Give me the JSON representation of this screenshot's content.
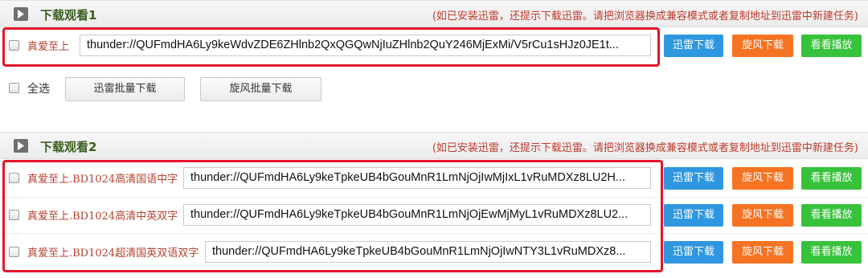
{
  "section1": {
    "title": "下载观看1",
    "hint": "(如已安装迅雷，还提示下载迅雷。请把浏览器换成兼容模式或者复制地址到迅雷中新建任务)",
    "items": [
      {
        "label": "真爱至上",
        "link": "thunder://QUFmdHA6Ly9keWdvZDE6ZHlnb2QxQGQwNjIuZHlnb2QuY246MjExMi/V5rCu1sHJz0JE1t..."
      }
    ],
    "select_all_label": "全选",
    "batch_xunlei": "迅雷批量下载",
    "batch_xuanfeng": "旋风批量下载"
  },
  "section2": {
    "title": "下载观看2",
    "hint": "(如已安装迅雷，还提示下载迅雷。请把浏览器换成兼容模式或者复制地址到迅雷中新建任务)",
    "items": [
      {
        "label": "真爱至上.BD1024高清国语中字",
        "link": "thunder://QUFmdHA6Ly9keTpkeUB4bGouMnR1LmNjOjIwMjIxL1vRuMDXz8LU2H..."
      },
      {
        "label": "真爱至上.BD1024高清中英双字",
        "link": "thunder://QUFmdHA6Ly9keTpkeUB4bGouMnR1LmNjOjEwMjMyL1vRuMDXz8LU2..."
      },
      {
        "label": "真爱至上.BD1024超清国英双语双字",
        "link": "thunder://QUFmdHA6Ly9keTpkeUB4bGouMnR1LmNjOjIwNTY3L1vRuMDXz8..."
      }
    ]
  },
  "buttons": {
    "xunlei": "迅雷下载",
    "xuanfeng": "旋风下载",
    "play": "看看播放"
  },
  "colors": {
    "title_green": "#3a5e1e",
    "hint_red": "#c0392b",
    "highlight_red": "#e3152b",
    "btn_blue": "#2f97e0",
    "btn_orange": "#f57322",
    "btn_green": "#37c23b"
  },
  "icons": {
    "section_icon": "play-icon"
  }
}
